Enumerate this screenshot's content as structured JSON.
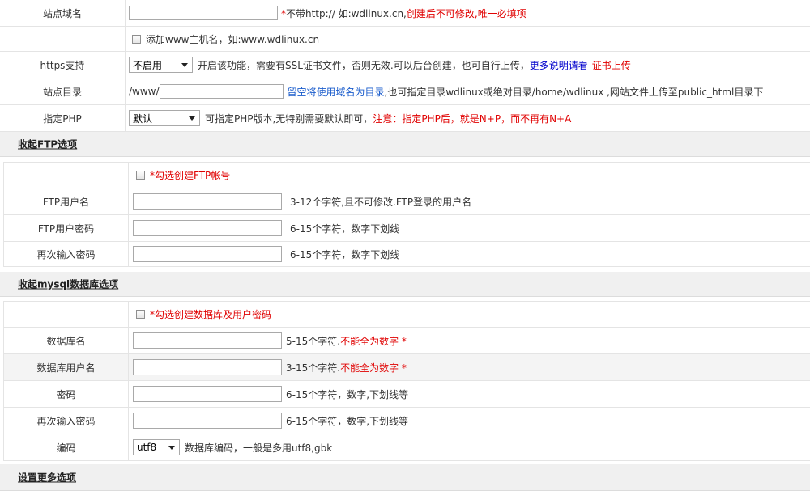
{
  "site": {
    "domain": {
      "label": "站点域名",
      "value": "",
      "hint_star": "*",
      "hint_plain": "不带http:// 如:wdlinux.cn,",
      "hint_red": "创建后不可修改,唯一必填项"
    },
    "add_www": {
      "checked": false,
      "label": "添加www主机名，如:www.wdlinux.cn"
    },
    "https": {
      "label": "https支持",
      "selected": "不启用",
      "hint": "开启该功能，需要有SSL证书文件，否则无效.可以后台创建，也可自行上传，",
      "link_more": "更多说明请看",
      "link_upload": "证书上传"
    },
    "dir": {
      "label": "站点目录",
      "prefix": "/www/",
      "value": "",
      "hint_blue": "留空将使用域名为目录",
      "hint_plain": ",也可指定目录wdlinux或绝对目录/home/wdlinux ,网站文件上传至public_html目录下"
    },
    "php": {
      "label": "指定PHP",
      "selected": "默认",
      "hint_plain": "可指定PHP版本,无特别需要默认即可，",
      "hint_red": "注意：指定PHP后，就是N+P，而不再有N+A"
    }
  },
  "ftp": {
    "toggle_label": "收起FTP选项",
    "create": {
      "checked": false,
      "label": "*勾选创建FTP帐号"
    },
    "username": {
      "label": "FTP用户名",
      "value": "",
      "hint": "3-12个字符,且不可修改.FTP登录的用户名"
    },
    "password": {
      "label": "FTP用户密码",
      "value": "",
      "hint": "6-15个字符，数字下划线"
    },
    "password_confirm": {
      "label": "再次输入密码",
      "value": "",
      "hint": "6-15个字符，数字下划线"
    }
  },
  "mysql": {
    "toggle_label": "收起mysql数据库选项",
    "create": {
      "checked": false,
      "label": "*勾选创建数据库及用户密码"
    },
    "dbname": {
      "label": "数据库名",
      "value": "",
      "hint_plain": "5-15个字符.",
      "hint_red": "不能全为数字 *"
    },
    "dbuser": {
      "label": "数据库用户名",
      "value": "",
      "hint_plain": "3-15个字符.",
      "hint_red": "不能全为数字 *"
    },
    "password": {
      "label": "密码",
      "value": "",
      "hint": "6-15个字符，数字,下划线等"
    },
    "password_confirm": {
      "label": "再次输入密码",
      "value": "",
      "hint": "6-15个字符，数字,下划线等"
    },
    "encoding": {
      "label": "编码",
      "selected": "utf8",
      "hint": "数据库编码，一般是多用utf8,gbk"
    }
  },
  "more": {
    "toggle_label": "设置更多选项"
  }
}
